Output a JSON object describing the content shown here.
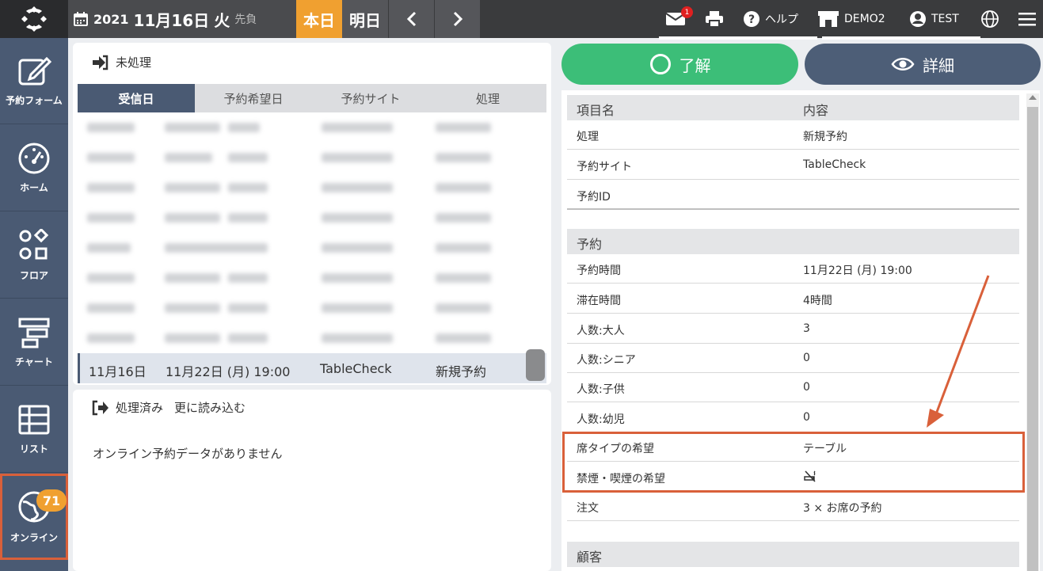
{
  "topbar": {
    "logo_icon": "app-logo-icon",
    "date": {
      "year": "2021",
      "month_day": "11月16日",
      "dow": "火",
      "rokuyo": "先負"
    },
    "today_label": "本日",
    "tomorrow_label": "明日",
    "mail_badge": "1",
    "help_label": "ヘルプ",
    "store_label": "DEMO2",
    "user_label": "TEST"
  },
  "sidebar": {
    "items": [
      {
        "label": "予約フォーム",
        "icon": "edit-icon"
      },
      {
        "label": "ホーム",
        "icon": "dashboard-gauge-icon"
      },
      {
        "label": "フロア",
        "icon": "floor-shapes-icon"
      },
      {
        "label": "チャート",
        "icon": "chart-bars-icon"
      },
      {
        "label": "リスト",
        "icon": "list-table-icon"
      },
      {
        "label": "オンライン",
        "icon": "globe-icon",
        "badge": "71"
      }
    ]
  },
  "pending": {
    "title": "未処理",
    "columns": [
      "受信日",
      "予約希望日",
      "予約サイト",
      "処理"
    ],
    "selected_row": {
      "received": "11月16日",
      "date": "11月22日 (月) 19:00",
      "site": "TableCheck",
      "action": "新規予約"
    }
  },
  "processed": {
    "title": "処理済み",
    "reload": "更に読み込む",
    "empty_message": "オンライン予約データがありません"
  },
  "actions": {
    "ok_label": "了解",
    "detail_label": "詳細"
  },
  "detail": {
    "header": {
      "name": "項目名",
      "value": "内容"
    },
    "basic_rows": [
      {
        "name": "処理",
        "value": "新規予約"
      },
      {
        "name": "予約サイト",
        "value": "TableCheck"
      },
      {
        "name": "予約ID",
        "value": ""
      }
    ],
    "reservation_title": "予約",
    "reservation_rows": [
      {
        "name": "予約時間",
        "value": "11月22日 (月) 19:00"
      },
      {
        "name": "滞在時間",
        "value": "4時間"
      },
      {
        "name": "人数:大人",
        "value": "3"
      },
      {
        "name": "人数:シニア",
        "value": "0"
      },
      {
        "name": "人数:子供",
        "value": "0"
      },
      {
        "name": "人数:幼児",
        "value": "0"
      },
      {
        "name": "席タイプの希望",
        "value": "テーブル"
      },
      {
        "name": "禁煙・喫煙の希望",
        "value": "",
        "icon": "no-smoking-icon"
      },
      {
        "name": "注文",
        "value": "3 × お席の予約"
      }
    ],
    "customer_title": "顧客"
  },
  "colors": {
    "accent_orange": "#f0a030",
    "sidebar": "#4a5a73",
    "ok_green": "#3cbe78",
    "highlight": "#d9603a"
  }
}
